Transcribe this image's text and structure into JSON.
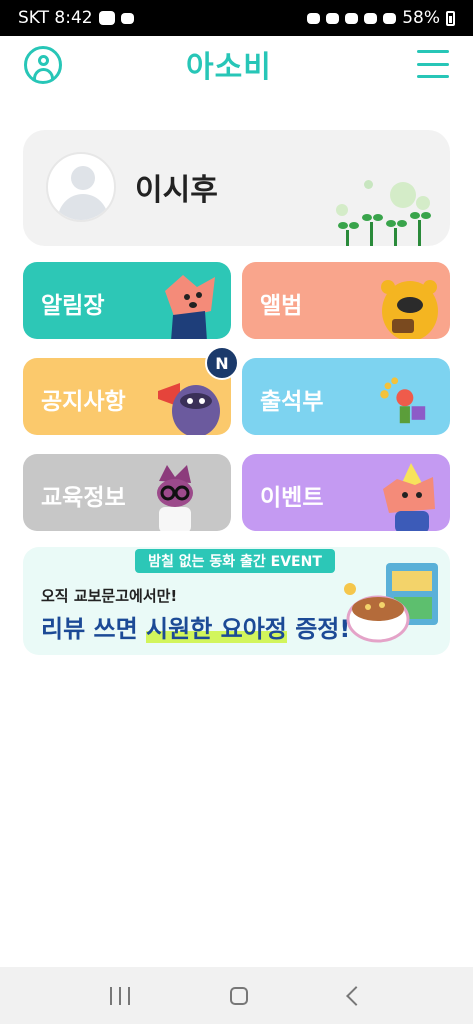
{
  "status_bar": {
    "carrier_time": "SKT 8:42",
    "battery": "58%"
  },
  "app": {
    "logo": "아소비"
  },
  "profile": {
    "name": "이시후"
  },
  "menu_tiles": [
    {
      "label": "알림장",
      "color": "#2dc7b6"
    },
    {
      "label": "앨범",
      "color": "#f9a58c"
    },
    {
      "label": "공지사항",
      "color": "#fbc96c",
      "badge": "N"
    },
    {
      "label": "출석부",
      "color": "#7dd3f0"
    },
    {
      "label": "교육정보",
      "color": "#c7c7c7"
    },
    {
      "label": "이벤트",
      "color": "#c49af2"
    }
  ],
  "banner": {
    "tag": "밤칠 없는 동화 출간 EVENT",
    "subtitle": "오직 교보문고에서만!",
    "title_prefix": "리뷰 쓰면 ",
    "title_highlight": "시원한 요아정",
    "title_suffix": " 증정!"
  },
  "colors": {
    "accent": "#27c6b7"
  }
}
